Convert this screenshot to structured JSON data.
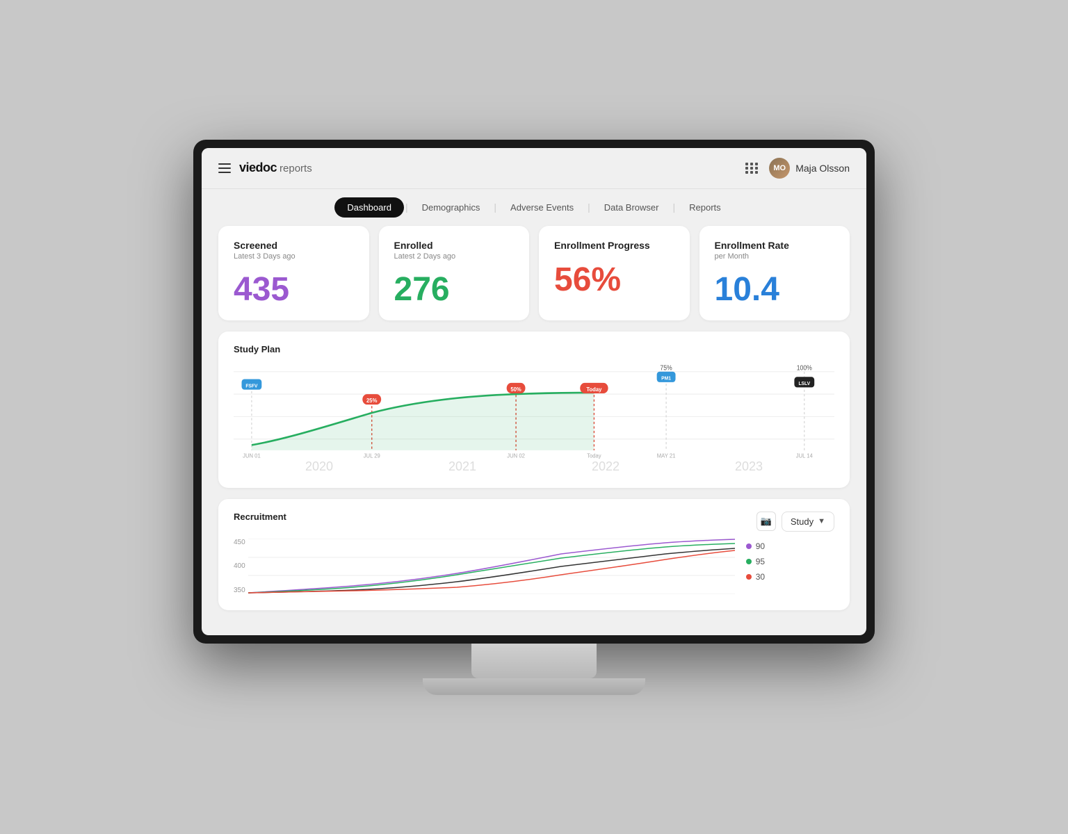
{
  "brand": {
    "name": "viedoc",
    "sub": "reports"
  },
  "user": {
    "name": "Maja Olsson",
    "initials": "MO"
  },
  "tabs": [
    {
      "id": "dashboard",
      "label": "Dashboard",
      "active": true
    },
    {
      "id": "demographics",
      "label": "Demographics",
      "active": false
    },
    {
      "id": "adverse-events",
      "label": "Adverse Events",
      "active": false
    },
    {
      "id": "data-browser",
      "label": "Data Browser",
      "active": false
    },
    {
      "id": "reports",
      "label": "Reports",
      "active": false
    }
  ],
  "kpis": [
    {
      "title": "Screened",
      "subtitle": "Latest 3 Days ago",
      "value": "435",
      "color": "purple"
    },
    {
      "title": "Enrolled",
      "subtitle": "Latest 2 Days ago",
      "value": "276",
      "color": "green"
    },
    {
      "title": "Enrollment Progress",
      "subtitle": "",
      "value": "56%",
      "color": "orange"
    },
    {
      "title": "Enrollment Rate",
      "subtitle": "per Month",
      "value": "10.4",
      "color": "blue"
    }
  ],
  "study_plan": {
    "title": "Study Plan",
    "milestones": [
      {
        "label": "FSFV",
        "color": "blue",
        "x_pct": 3
      },
      {
        "label": "25%",
        "color": "orange",
        "x_pct": 23
      },
      {
        "label": "50%",
        "color": "orange",
        "x_pct": 47
      },
      {
        "label": "Today",
        "color": "orange",
        "x_pct": 60
      },
      {
        "label": "PM1",
        "color": "blue",
        "x_pct": 72
      },
      {
        "label": "LSLV",
        "color": "dark",
        "x_pct": 95
      }
    ],
    "pct_labels": [
      "75%",
      "100%"
    ],
    "date_labels": [
      "JUN 01",
      "JUL 29",
      "JUN 02",
      "Today",
      "MAY 21",
      "JUL 14"
    ],
    "year_labels": [
      "2020",
      "2021",
      "2022",
      "2023"
    ]
  },
  "recruitment": {
    "title": "Recruitment",
    "y_labels": [
      "450",
      "400",
      "350"
    ],
    "dropdown_label": "Study",
    "legend": [
      {
        "label": "90",
        "color": "#9b59d0"
      },
      {
        "label": "95",
        "color": "#27ae60"
      },
      {
        "label": "30",
        "color": "#e74c3c"
      }
    ]
  }
}
